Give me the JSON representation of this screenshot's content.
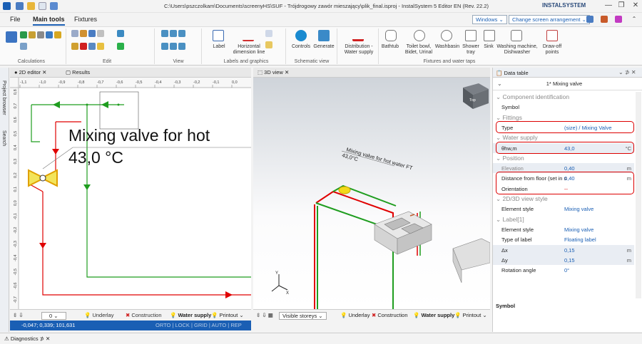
{
  "titlebar": {
    "title": "C:\\Users\\pszczolkam\\Documents\\screenyHS\\SUF - Trójdrogowy zawór mieszający\\plik_final.isproj - InstalSystem 5 Editor EN (Rev. 22.2)",
    "logo": "INSTALSYSTEM"
  },
  "ribbon_tabs": [
    "File",
    "Main tools",
    "Fixtures"
  ],
  "windows_label": "Windows",
  "arrangement_label": "Change screen arrangement",
  "ribbon": {
    "groups": {
      "calculations": "Calculations",
      "edit": "Edit",
      "view": "View",
      "labels": "Labels and graphics",
      "schematic": "Schematic view",
      "fixtures": "Fixtures and water taps"
    },
    "label": "Label",
    "horizontal": "Horizontal dimension line",
    "controls": "Controls",
    "generate": "Generate",
    "distribution": "Distribution - Water supply",
    "bathtub": "Bathtub",
    "toilet": "Toilet bowl, Bidet, Urinal",
    "washbasin": "Washbasin",
    "shower": "Shower tray",
    "sink": "Sink",
    "washing": "Washing machine, Dishwasher",
    "drawoff": "Draw-off points"
  },
  "panel2d": {
    "tab": "2D editor",
    "tab2": "Results",
    "ruler": [
      "-1,1",
      "-1,0",
      "-0,9",
      "-0,8",
      "-0,7",
      "-0,6",
      "-0,5",
      "-0,4",
      "-0,3",
      "-0,2",
      "-0,1",
      "0,0"
    ],
    "vruler": [
      "0,8",
      "0,7",
      "0,6",
      "0,5",
      "0,4",
      "0,3",
      "0,2",
      "0,1",
      "0,0",
      "-0,1",
      "-0,2",
      "-0,3",
      "-0,4",
      "-0,5",
      "-0,6",
      "-0,7"
    ],
    "label_line1": "Mixing valve for hot",
    "label_line2": "43,0 °C"
  },
  "panel3d": {
    "tab": "3D view",
    "label_line1": "Mixing valve for hot water FT",
    "label_line2": "43,0°C",
    "cube_label": "Top"
  },
  "left_strip": {
    "project_browser": "Project browser",
    "search": "Search"
  },
  "bottom2d": {
    "layer": "0",
    "underlay": "Underlay",
    "construction": "Construction",
    "water_supply": "Water supply",
    "printout": "Printout"
  },
  "bottom3d": {
    "visible_storeys": "Visible storeys",
    "underlay": "Underlay",
    "construction": "Construction",
    "water_supply": "Water supply",
    "printout": "Printout"
  },
  "status": {
    "coords": "-0,047; 0,339; 101,631",
    "modes": "ORTO | LOCK | GRID | AUTO | REP"
  },
  "diagnostics": "Diagnostics",
  "datatable": {
    "title": "Data table",
    "subtitle": "1* Mixing valve",
    "rows": [
      {
        "type": "section",
        "key": "Component identification"
      },
      {
        "key": "Symbol",
        "value": "",
        "unit": ""
      },
      {
        "type": "section",
        "key": "Fittings"
      },
      {
        "key": "Type",
        "value": "(size) / Mixing Valve",
        "unit": ""
      },
      {
        "type": "section",
        "key": "Water supply"
      },
      {
        "key": "θhw,m",
        "value": "43,0",
        "unit": "°C"
      },
      {
        "type": "section",
        "key": "Position"
      },
      {
        "key": "Elevation",
        "value": "0,40",
        "unit": "m"
      },
      {
        "key": "Distance from floor (set in s",
        "value": "0,40",
        "unit": "m"
      },
      {
        "key": "Orientation",
        "value": "--",
        "unit": ""
      },
      {
        "type": "section",
        "key": "2D/3D view style"
      },
      {
        "key": "Element style",
        "value": "Mixing valve",
        "unit": ""
      },
      {
        "type": "section",
        "key": "Label[1]"
      },
      {
        "key": "Element style",
        "value": "Mixing valve",
        "unit": ""
      },
      {
        "key": "Type of label",
        "value": "Floating label",
        "unit": ""
      },
      {
        "key": "Δx",
        "value": "0,15",
        "unit": "m"
      },
      {
        "key": "Δy",
        "value": "0,15",
        "unit": "m"
      },
      {
        "key": "Rotation angle",
        "value": "0°",
        "unit": ""
      }
    ],
    "footer": "Symbol"
  },
  "colors": {
    "accent": "#1a5fb4",
    "pipe_red": "#e00000",
    "pipe_green": "#1f9d1f",
    "highlight": "#d00000"
  }
}
